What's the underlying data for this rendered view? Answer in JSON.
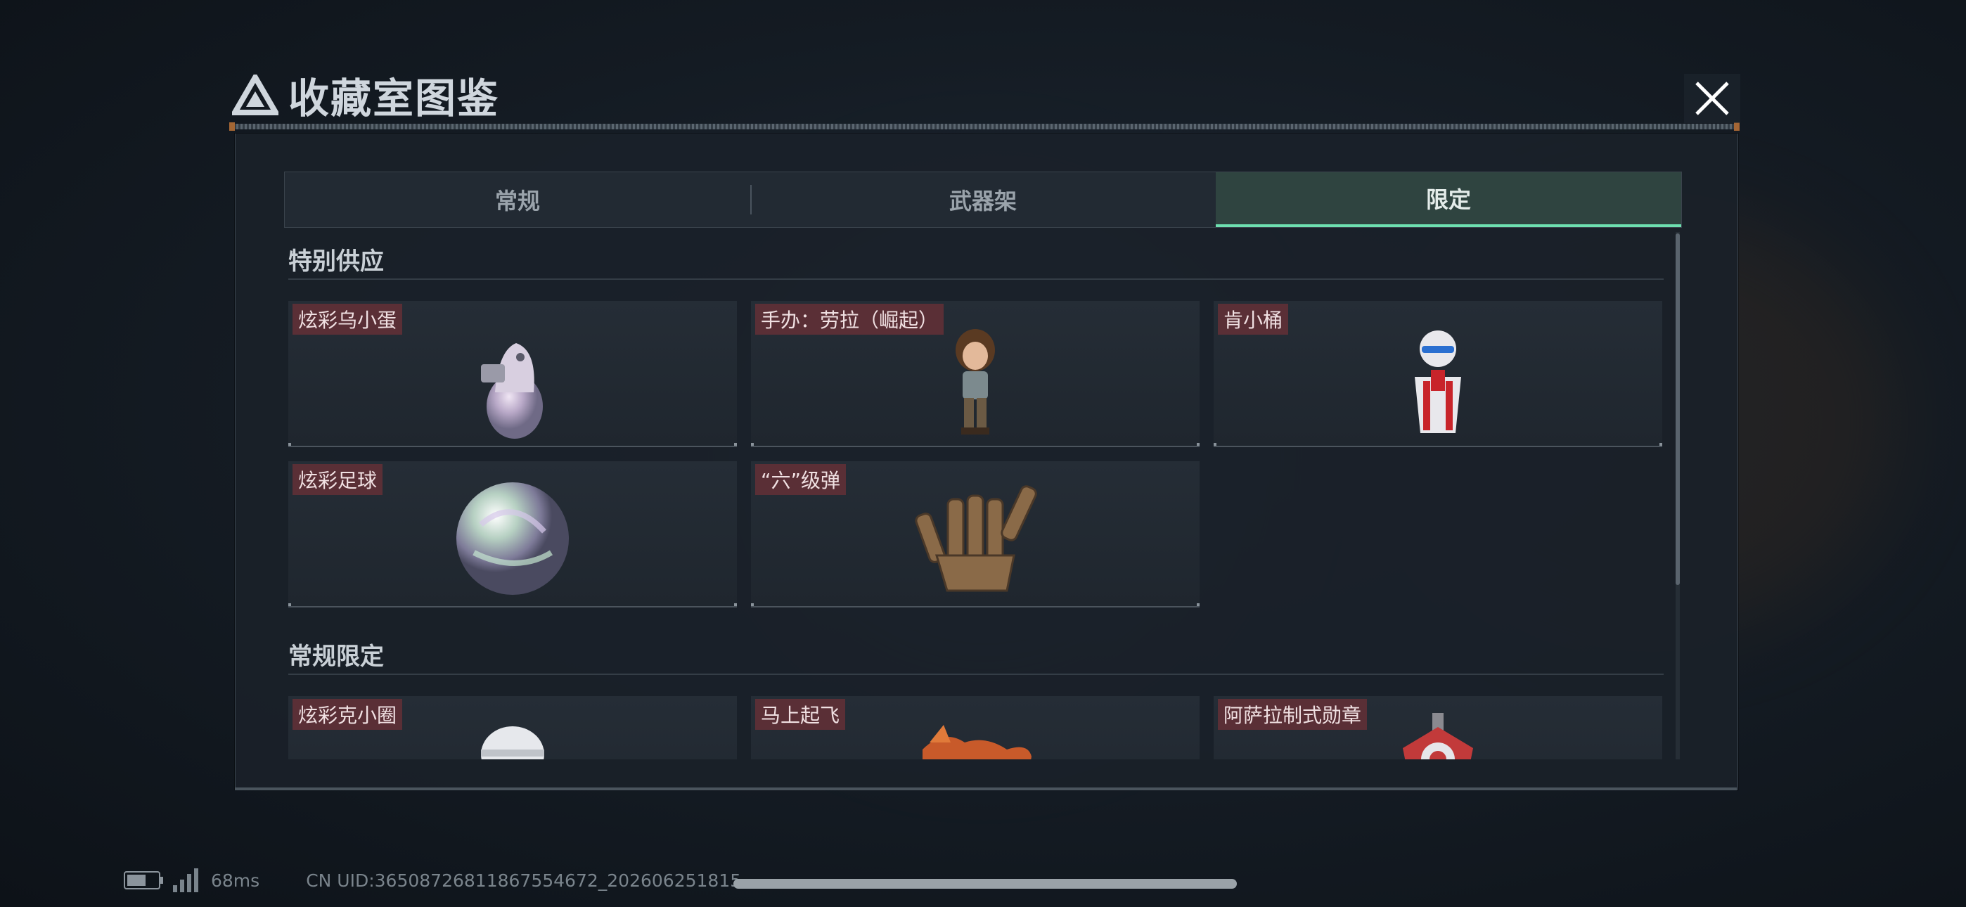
{
  "header": {
    "title": "收藏室图鉴"
  },
  "tabs": [
    {
      "label": "常规",
      "active": false
    },
    {
      "label": "武器架",
      "active": false
    },
    {
      "label": "限定",
      "active": true
    }
  ],
  "sections": [
    {
      "title": "特别供应",
      "items": [
        {
          "label": "炫彩乌小蛋",
          "icon": "egg-creature-icon"
        },
        {
          "label": "手办：劳拉（崛起）",
          "icon": "figure-icon"
        },
        {
          "label": "肯小桶",
          "icon": "bucket-mascot-icon"
        },
        {
          "label": "炫彩足球",
          "icon": "football-icon"
        },
        {
          "label": "“六”级弹",
          "icon": "bullet-hand-icon"
        }
      ]
    },
    {
      "title": "常规限定",
      "items": [
        {
          "label": "炫彩克小圈",
          "icon": "skull-icon"
        },
        {
          "label": "马上起飞",
          "icon": "horse-icon"
        },
        {
          "label": "阿萨拉制式勋章",
          "icon": "medal-icon"
        }
      ]
    }
  ],
  "status": {
    "ping": "68ms",
    "uid": "CN UID:365087268118675546​72_202606251815"
  },
  "colors": {
    "accent": "#6ee0b0",
    "label_bg": "#5a2f36",
    "panel_bg": "#1a2129"
  }
}
